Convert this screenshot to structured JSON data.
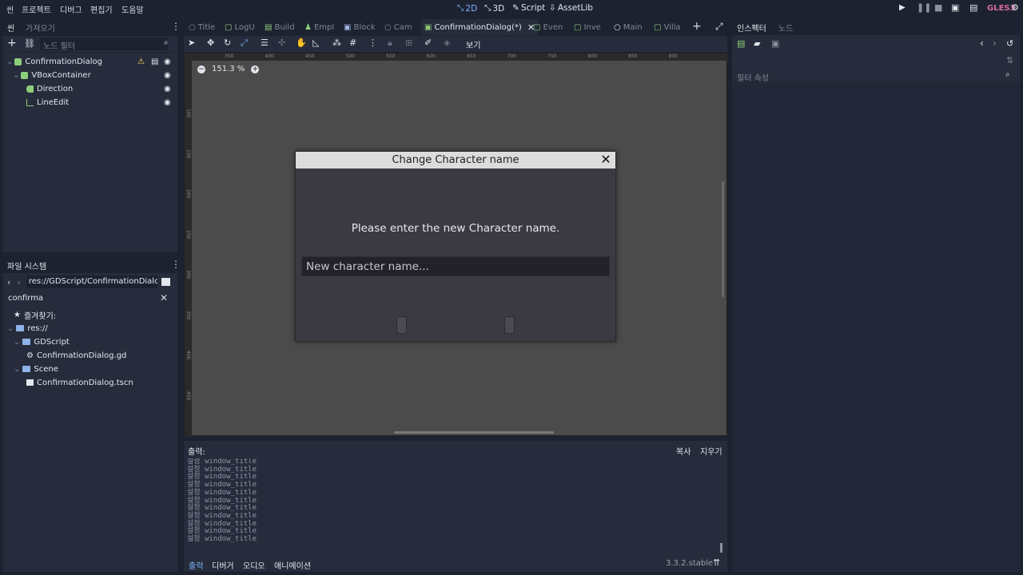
{
  "menubar": {
    "items": [
      "씬",
      "프로젝트",
      "디버그",
      "편집기",
      "도움말"
    ],
    "workspaces": [
      "2D",
      "3D",
      "Script",
      "AssetLib"
    ],
    "active_workspace": "2D",
    "renderer": "GLES3"
  },
  "scene_dock": {
    "tabs": [
      "씬",
      "가져오기"
    ],
    "filter_placeholder": "노드 필터",
    "nodes": [
      {
        "name": "ConfirmationDialog",
        "depth": 0
      },
      {
        "name": "VBoxContainer",
        "depth": 1
      },
      {
        "name": "Direction",
        "depth": 2
      },
      {
        "name": "LineEdit",
        "depth": 2
      }
    ]
  },
  "filesystem": {
    "title": "파일 시스템",
    "path": "res://GDScript/ConfirmationDialog.gd",
    "search_value": "confirma",
    "favorites_label": "즐겨찾기:",
    "root": "res://",
    "items": [
      {
        "name": "GDScript",
        "type": "folder",
        "depth": 1
      },
      {
        "name": "ConfirmationDialog.gd",
        "type": "script",
        "depth": 2
      },
      {
        "name": "Scene",
        "type": "folder",
        "depth": 1
      },
      {
        "name": "ConfirmationDialog.tscn",
        "type": "scene",
        "depth": 2
      }
    ]
  },
  "scene_tabs": [
    {
      "label": "Title",
      "active": false
    },
    {
      "label": "LogU",
      "active": false
    },
    {
      "label": "Build",
      "active": false
    },
    {
      "label": "Empl",
      "active": false
    },
    {
      "label": "Block",
      "active": false
    },
    {
      "label": "Cam",
      "active": false
    },
    {
      "label": "ConfirmationDialog(*)",
      "active": true
    },
    {
      "label": "Even",
      "active": false
    },
    {
      "label": "Inve",
      "active": false
    },
    {
      "label": "Main",
      "active": false
    },
    {
      "label": "Villa",
      "active": false
    }
  ],
  "toolbar2d": {
    "view_label": "보기"
  },
  "viewport": {
    "zoom": "151.3 %",
    "ruler_top_ticks": [
      "350",
      "400",
      "450",
      "500",
      "550",
      "600",
      "650",
      "700",
      "750",
      "800",
      "850",
      "900"
    ],
    "ruler_left_ticks": [
      "100",
      "150",
      "200",
      "250",
      "300",
      "350",
      "400",
      "450"
    ]
  },
  "dialog": {
    "title": "Change Character name",
    "message": "Please enter the new Character name.",
    "input_placeholder": "New character name..."
  },
  "output": {
    "title": "출력:",
    "copy_label": "복사",
    "clear_label": "지우기",
    "lines": [
      "설정 window_title",
      "설정 window_title",
      "설정 window_title",
      "설정 window_title",
      "설정 window_title",
      "설정 window_title",
      "설정 window_title",
      "설정 window_title",
      "설정 window_title",
      "설정 window_title",
      "설정 window_title"
    ],
    "bottom_tabs": [
      "출력",
      "디버거",
      "오디오",
      "애니메이션"
    ],
    "version": "3.3.2.stable"
  },
  "inspector": {
    "tabs": [
      "인스펙터",
      "노드"
    ],
    "filter_placeholder": "필터 속성"
  },
  "colors": {
    "accent": "#7fb3ff",
    "panel": "#262c3b",
    "background": "#1d2230",
    "viewport": "#4b4b4b",
    "warning": "#ffdd55"
  }
}
